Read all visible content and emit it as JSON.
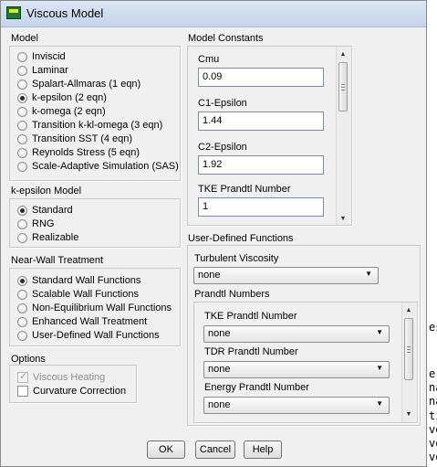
{
  "window": {
    "title": "Viscous Model"
  },
  "model": {
    "label": "Model",
    "options": [
      {
        "label": "Inviscid",
        "selected": false
      },
      {
        "label": "Laminar",
        "selected": false
      },
      {
        "label": "Spalart-Allmaras (1 eqn)",
        "selected": false
      },
      {
        "label": "k-epsilon (2 eqn)",
        "selected": true
      },
      {
        "label": "k-omega (2 eqn)",
        "selected": false
      },
      {
        "label": "Transition k-kl-omega (3 eqn)",
        "selected": false
      },
      {
        "label": "Transition SST (4 eqn)",
        "selected": false
      },
      {
        "label": "Reynolds Stress (5 eqn)",
        "selected": false
      },
      {
        "label": "Scale-Adaptive Simulation (SAS)",
        "selected": false
      }
    ]
  },
  "ke_model": {
    "label": "k-epsilon Model",
    "options": [
      {
        "label": "Standard",
        "selected": true
      },
      {
        "label": "RNG",
        "selected": false
      },
      {
        "label": "Realizable",
        "selected": false
      }
    ]
  },
  "near_wall": {
    "label": "Near-Wall Treatment",
    "options": [
      {
        "label": "Standard Wall Functions",
        "selected": true
      },
      {
        "label": "Scalable Wall Functions",
        "selected": false
      },
      {
        "label": "Non-Equilibrium Wall Functions",
        "selected": false
      },
      {
        "label": "Enhanced Wall Treatment",
        "selected": false
      },
      {
        "label": "User-Defined Wall Functions",
        "selected": false
      }
    ]
  },
  "options": {
    "label": "Options",
    "viscous_heating": {
      "label": "Viscous Heating",
      "checked": true,
      "enabled": false
    },
    "curvature_correction": {
      "label": "Curvature Correction",
      "checked": false,
      "enabled": true
    }
  },
  "constants": {
    "label": "Model Constants",
    "items": [
      {
        "label": "Cmu",
        "value": "0.09"
      },
      {
        "label": "C1-Epsilon",
        "value": "1.44"
      },
      {
        "label": "C2-Epsilon",
        "value": "1.92"
      },
      {
        "label": "TKE Prandtl Number",
        "value": "1"
      }
    ]
  },
  "udf": {
    "label": "User-Defined Functions",
    "turbulent_viscosity": {
      "label": "Turbulent Viscosity",
      "value": "none"
    },
    "prandtl_numbers": {
      "label": "Prandtl Numbers",
      "items": [
        {
          "label": "TKE Prandtl Number",
          "value": "none"
        },
        {
          "label": "TDR Prandtl Number",
          "value": "none"
        },
        {
          "label": "Energy Prandtl Number",
          "value": "none"
        }
      ]
    }
  },
  "buttons": {
    "ok": "OK",
    "cancel": "Cancel",
    "help": "Help"
  },
  "background_text": [
    "es",
    "er",
    "na",
    "na",
    "ti",
    "vo",
    "vo",
    "vo"
  ]
}
